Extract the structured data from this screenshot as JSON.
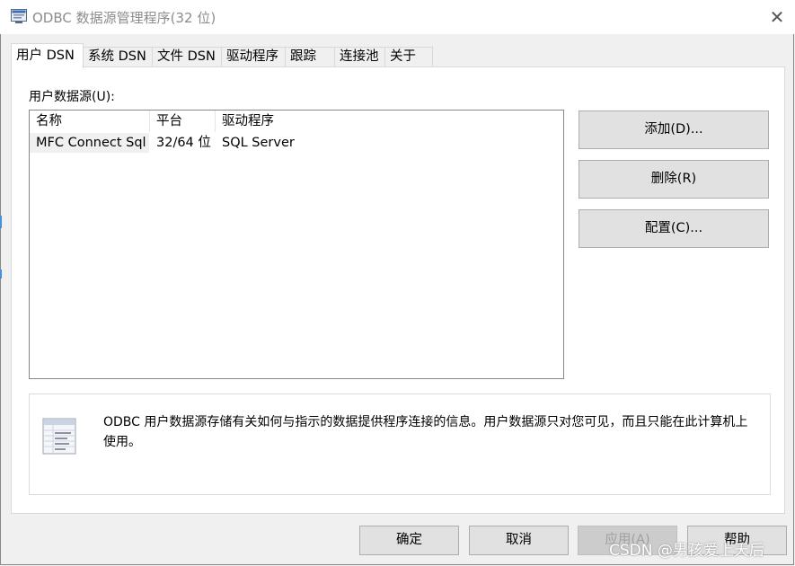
{
  "window": {
    "title": "ODBC 数据源管理程序(32 位)",
    "close_glyph": "✕"
  },
  "tabs": [
    {
      "label": "用户 DSN",
      "active": true
    },
    {
      "label": "系统 DSN"
    },
    {
      "label": "文件 DSN"
    },
    {
      "label": "驱动程序"
    },
    {
      "label": "跟踪"
    },
    {
      "label": "连接池"
    },
    {
      "label": "关于"
    }
  ],
  "user_dsn": {
    "group_label": "用户数据源(U):",
    "columns": [
      "名称",
      "平台",
      "驱动程序"
    ],
    "rows": [
      {
        "name": "MFC Connect Sql",
        "platform": "32/64 位",
        "driver": "SQL Server"
      }
    ],
    "buttons": {
      "add": "添加(D)...",
      "remove": "删除(R)",
      "configure": "配置(C)..."
    },
    "info_text": "ODBC 用户数据源存储有关如何与指示的数据提供程序连接的信息。用户数据源只对您可见，而且只能在此计算机上使用。"
  },
  "footer": {
    "ok": "确定",
    "cancel": "取消",
    "apply": "应用(A)",
    "help": "帮助"
  },
  "watermark": "CSDN @男孩爱上天后",
  "icons": {
    "app": "odbc-admin-icon",
    "info": "database-document-icon"
  },
  "colors": {
    "title_text": "#8c8c8c",
    "button_face": "#e1e1e1",
    "disabled_button": "#cccccc"
  }
}
